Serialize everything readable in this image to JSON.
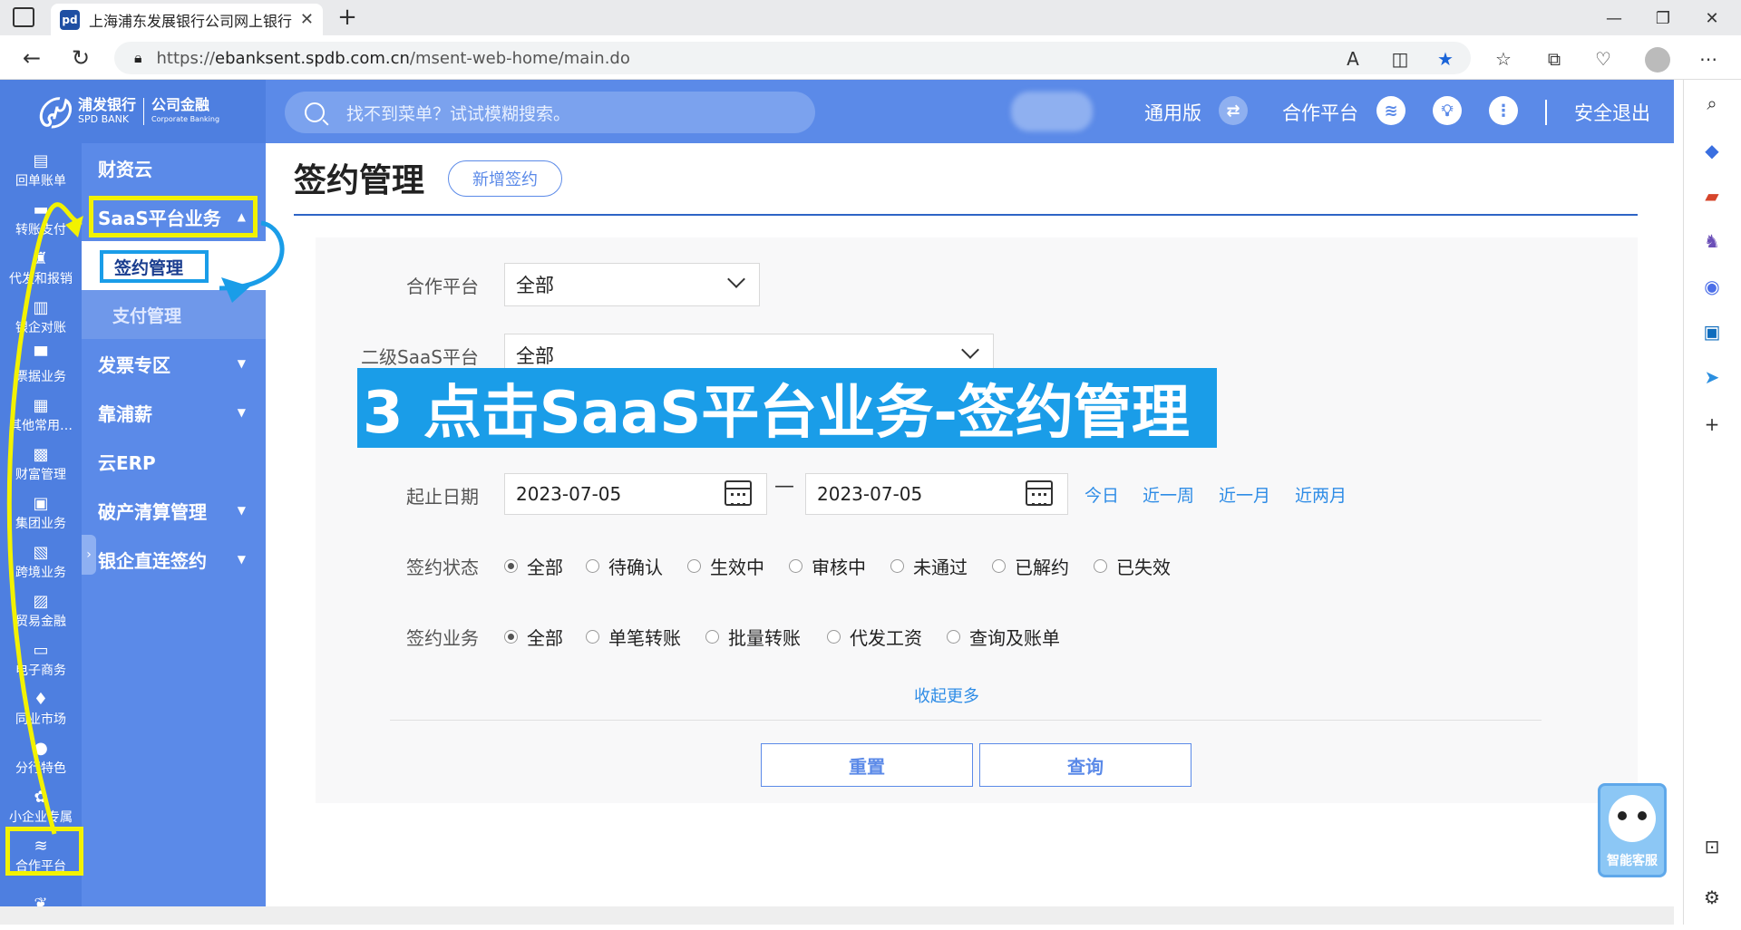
{
  "browser": {
    "tab_title": "上海浦东发展银行公司网上银行",
    "tab_favicon": "pd",
    "url_prefix": "https://",
    "url_host": "ebanksent.spdb.com.cn",
    "url_path": "/msent-web-home/main.do"
  },
  "header": {
    "logo_cn": "浦发银行",
    "logo_en": "SPD BANK",
    "logo_sub_cn": "公司金融",
    "logo_sub_en": "Corporate Banking",
    "search_placeholder": "找不到菜单？试试模糊搜索。",
    "version_label": "通用版",
    "partner_label": "合作平台",
    "logout_label": "安全退出"
  },
  "icon_nav": [
    {
      "label": "回单账单",
      "icon": "receipt-icon",
      "glyph": "▤"
    },
    {
      "label": "转账支付",
      "icon": "transfer-icon",
      "glyph": "▬"
    },
    {
      "label": "代发和报销",
      "icon": "payroll-icon",
      "glyph": "♜"
    },
    {
      "label": "银企对账",
      "icon": "reconcile-icon",
      "glyph": "▥"
    },
    {
      "label": "票据业务",
      "icon": "bill-icon",
      "glyph": "▀"
    },
    {
      "label": "其他常用…",
      "icon": "grid-icon",
      "glyph": "▦"
    },
    {
      "label": "财富管理",
      "icon": "wealth-icon",
      "glyph": "▩"
    },
    {
      "label": "集团业务",
      "icon": "group-icon",
      "glyph": "▣"
    },
    {
      "label": "跨境业务",
      "icon": "crossborder-icon",
      "glyph": "▧"
    },
    {
      "label": "贸易金融",
      "icon": "trade-icon",
      "glyph": "▨"
    },
    {
      "label": "电子商务",
      "icon": "cart-icon",
      "glyph": "▭"
    },
    {
      "label": "同业市场",
      "icon": "interbank-icon",
      "glyph": "♦"
    },
    {
      "label": "分行特色",
      "icon": "branch-icon",
      "glyph": "●"
    },
    {
      "label": "小企业专属",
      "icon": "sme-icon",
      "glyph": "✿"
    },
    {
      "label": "合作平台",
      "icon": "layers-icon",
      "glyph": "≋"
    },
    {
      "label": "",
      "icon": "more-icon",
      "glyph": "❦"
    }
  ],
  "menu": {
    "caiziyun": "财资云",
    "saas": "SaaS平台业务",
    "sub_sign": "签约管理",
    "sub_pay": "支付管理",
    "invoice": "发票专区",
    "kaopuxin": "靠浦薪",
    "yunerp": "云ERP",
    "bankruptcy": "破产清算管理",
    "direct": "银企直连签约"
  },
  "page": {
    "title": "签约管理",
    "add_button": "新增签约",
    "partner_label": "合作平台",
    "partner_value": "全部",
    "saas2_label": "二级SaaS平台",
    "saas2_value": "全部",
    "date_label": "起止日期",
    "date_start": "2023-07-05",
    "date_end": "2023-07-05",
    "date_dash": "—",
    "quick": [
      "今日",
      "近一周",
      "近一月",
      "近两月"
    ],
    "status_label": "签约状态",
    "status_options": [
      "全部",
      "待确认",
      "生效中",
      "审核中",
      "未通过",
      "已解约",
      "已失效"
    ],
    "business_label": "签约业务",
    "business_options": [
      "全部",
      "单笔转账",
      "批量转账",
      "代发工资",
      "查询及账单"
    ],
    "collapse_more": "收起更多",
    "reset": "重置",
    "query": "查询"
  },
  "annotation": {
    "banner": "3 点击SaaS平台业务-签约管理"
  },
  "assistant": {
    "label": "智能客服"
  },
  "colors": {
    "primary": "#5b8ae8",
    "banner": "#1a9de8",
    "highlight": "#f2f200"
  }
}
